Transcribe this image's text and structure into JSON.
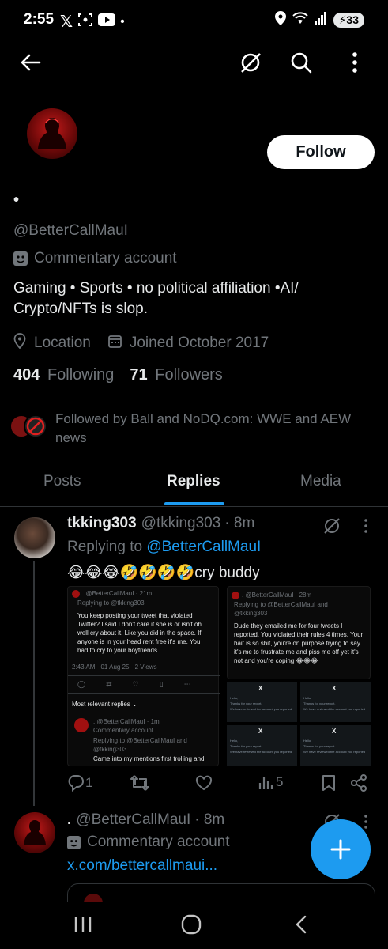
{
  "status_bar": {
    "time": "2:55",
    "dot": "•",
    "battery": "33",
    "signal_label": "6"
  },
  "profile": {
    "display_name": "•",
    "handle": "@BetterCallMauI",
    "account_type": "Commentary account",
    "bio_line1": "Gaming • Sports • no political affiliation •AI/",
    "bio_line2": "Crypto/NFTs is slop.",
    "location": "Location",
    "joined": "Joined October 2017",
    "following_count": "404",
    "following_label": "Following",
    "followers_count": "71",
    "followers_label": "Followers",
    "followed_by_line1": "Followed by Ball and NoDQ.com: WWE and AEW",
    "followed_by_line2": "news",
    "follow_label": "Follow"
  },
  "tabs": [
    {
      "label": "Posts"
    },
    {
      "label": "Replies"
    },
    {
      "label": "Media"
    }
  ],
  "reply_post": {
    "name": "tkking303",
    "handle": "@tkking303",
    "time": "· 8m",
    "replying_label": "Replying to ",
    "replying_handle": "@BetterCallMauI",
    "text": "😂😂😂🤣🤣🤣🤣cry buddy",
    "reply_count": "1",
    "view_count": "5",
    "left_shot": {
      "author": ". @BetterCallMauI · 21m",
      "replying": "Replying to @tkking303",
      "body": "You keep posting your tweet that violated Twitter? I said I don't care if she is or isn't oh well cry about it. Like you did in the space. If anyone is in your head rent free it's me. You had to cry to your boyfriends.",
      "meta": "2:43 AM · 01 Aug 25 · 2 Views",
      "relevant": "Most relevant replies ⌄",
      "sub_author": ". @BetterCallMauI · 1m",
      "sub_badge": "Commentary account",
      "sub_replying": "Replying to @BetterCallMauI and @tkking303",
      "sub_body": "Came into my mentions first trolling and"
    },
    "right_shot": {
      "author": ". @BetterCallMauI · 28m",
      "replying": "Replying to @BetterCallMauI and @tkking303",
      "body": "Dude they emailed me for four tweets I reported. You violated their rules 4 times. Your bait is so shit, you're on purpose trying to say it's me to frustrate me and piss me off yet it's not and you're coping 😂😂😂"
    },
    "grid_cells": [
      {
        "x": "X",
        "hello": "Hello,",
        "thanks": "Thanks for your report.",
        "reviewed": "We have reviewed the account you reported"
      },
      {
        "x": "X",
        "hello": "Hello,",
        "thanks": "Thanks for your report.",
        "reviewed": "We have reviewed the account you reported"
      },
      {
        "x": "X",
        "hello": "Hello,",
        "thanks": "Thanks for your report.",
        "reviewed": "We have reviewed the account you reported"
      },
      {
        "x": "X",
        "hello": "Hello,",
        "thanks": "Thanks for your report.",
        "reviewed": "We have reviewed the account you reported"
      }
    ]
  },
  "second_post": {
    "name": ".",
    "handle": "@BetterCallMauI",
    "time": "· 8m",
    "account_type": "Commentary account",
    "link": "x.com/bettercallmaui..."
  },
  "colors": {
    "accent": "#1d9bf0",
    "background": "#000000",
    "muted": "#71767b",
    "text": "#e7e9ea"
  }
}
